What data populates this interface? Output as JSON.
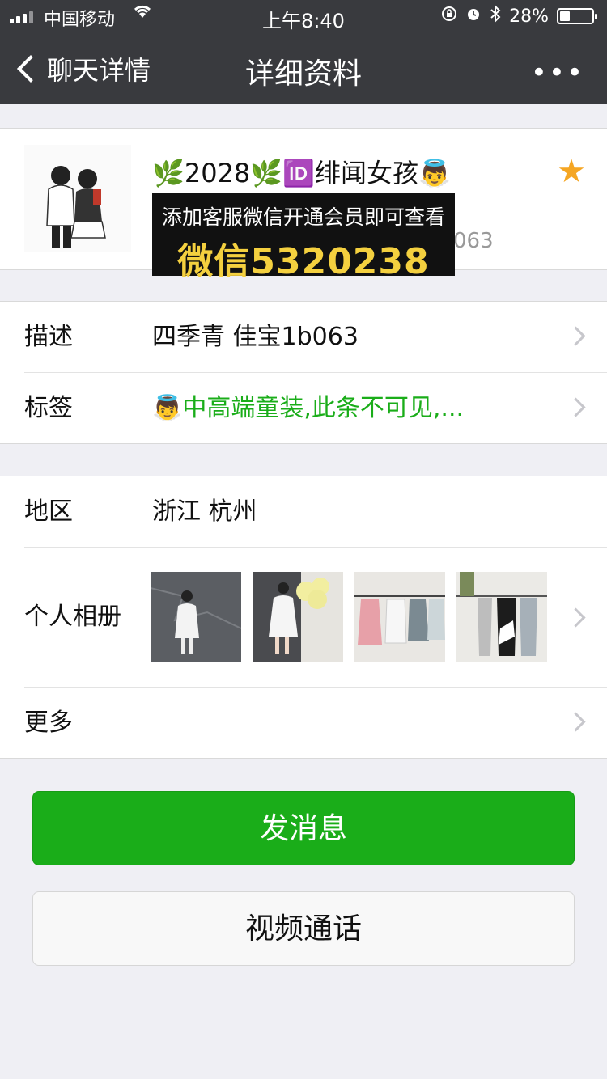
{
  "status": {
    "carrier": "中国移动",
    "time": "上午8:40",
    "battery": "28%",
    "battery_level": 0.28
  },
  "nav": {
    "back_label": "聊天详情",
    "title": "详细资料",
    "more": "•••"
  },
  "profile": {
    "name": "🌿2028🌿🆔绯闻女孩👼",
    "sub_text": "063",
    "promo_line1": "添加客服微信开通会员即可查看",
    "promo_line2": "微信5320238",
    "starred": true
  },
  "rows": {
    "description": {
      "label": "描述",
      "value": "四季青 佳宝1b063"
    },
    "tags": {
      "label": "标签",
      "value": "👼中高端童装,此条不可见,..."
    },
    "region": {
      "label": "地区",
      "value": "浙江 杭州"
    },
    "album": {
      "label": "个人相册"
    },
    "more": {
      "label": "更多"
    }
  },
  "buttons": {
    "message": "发消息",
    "video_call": "视频通话"
  },
  "colors": {
    "nav_bg": "#393a3e",
    "page_bg": "#efeff4",
    "accent_green": "#1aad19",
    "star": "#f5a623"
  }
}
